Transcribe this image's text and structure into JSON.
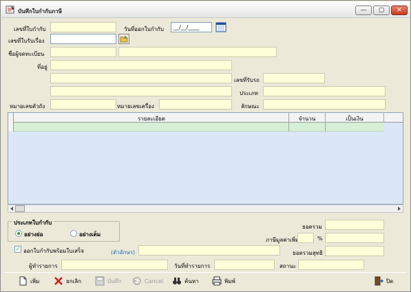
{
  "window": {
    "title": "บันทึกใบกำกับภาษี",
    "min": "—",
    "max": "▢",
    "close": "✕"
  },
  "form": {
    "invoice_no_label": "เลขที่ใบกำกับ",
    "issue_date_label": "วันที่ออกใบกำกับ",
    "issue_date_value": "__/__/____",
    "receipt_no_label": "เลขที่ใบรับเรื่อง",
    "registrant_label": "ชื่อผู้จดทะเบียน",
    "address_label": "ที่อยู่",
    "chassis_no_label": "เลขที่รับรถ",
    "type_label": "ประเภท",
    "body_no_label": "หมายเลขตัวถัง",
    "engine_no_label": "หมายเลขเครื่อง",
    "character_label": "ลักษณะ"
  },
  "grid": {
    "columns": [
      "รายละเอียด",
      "จำนวน",
      "เป็นเงิน"
    ]
  },
  "invoice_type": {
    "title": "ประเภทใบกำกับ",
    "options": [
      "อย่างย่อ",
      "อย่างเต็ม"
    ],
    "selected": "อย่างย่อ"
  },
  "totals": {
    "sum_label": "ยอดรวม",
    "vat_label": "ภาษีมูลค่าเพิ่ม",
    "vat_unit": "%",
    "net_label": "ยอดรวมสุทธิ"
  },
  "print_with_receipt_label": "ออกใบกำกับพร้อมใบเสร็จ",
  "text_amount_label": "(ตัวอักษร)",
  "footer": {
    "operator_label": "ผู้ทำรายการ",
    "op_date_label": "วันที่ทำรายการ",
    "status_label": "สถานะ"
  },
  "toolbar": {
    "add": "เพิ่ม",
    "cancel_item": "ยกเลิก",
    "save": "บันทึก",
    "cancel": "Cancel",
    "search": "ค้นหา",
    "print": "พิมพ์",
    "close": "ปิด"
  },
  "colors": {
    "field_bg": "#fefed8",
    "grid_bg": "#dbe7f6",
    "row_bg": "#d6efd6",
    "accent_green": "#21a121",
    "close_red": "#c8391b"
  }
}
